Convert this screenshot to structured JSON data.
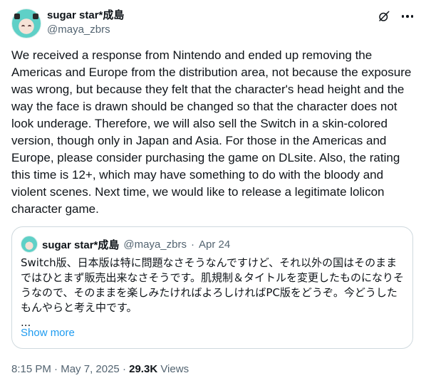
{
  "author": {
    "display_name": "sugar star*成島",
    "handle": "@maya_zbrs"
  },
  "tweet": {
    "text": "We received a response from Nintendo and ended up removing the Americas and Europe from the distribution area, not because the exposure was wrong, but because they felt that the character's head height and the way the face is drawn should be changed so that the character does not look underage. Therefore, we will also sell the Switch in a skin-colored version, though only in Japan and Asia. For those in the Americas and Europe, please consider purchasing the game on DLsite. Also, the rating this time is 12+, which may have something to do with the bloody and violent scenes. Next time, we would like to release a legitimate lolicon character game."
  },
  "quote": {
    "display_name": "sugar star*成島",
    "handle": "@maya_zbrs",
    "separator": "·",
    "date": "Apr 24",
    "text_lines": [
      "Switch版、日本版は特に問題なさそうなんですけど、それ以外の国はそのまま",
      "ではひとまず販売出来なさそうです。肌規制＆タイトルを変更したものになりそ",
      "うなので、そのままを楽しみたければよろしければPC版をどうぞ。今どうした",
      "もんやらと考え中です。",
      "..."
    ],
    "show_more": "Show more"
  },
  "footer": {
    "time": "8:15 PM",
    "separator": "·",
    "date": "May 7, 2025",
    "views_count": "29.3K",
    "views_label": "Views"
  },
  "icons": {
    "grok": "grok-icon",
    "more": "more-icon"
  }
}
